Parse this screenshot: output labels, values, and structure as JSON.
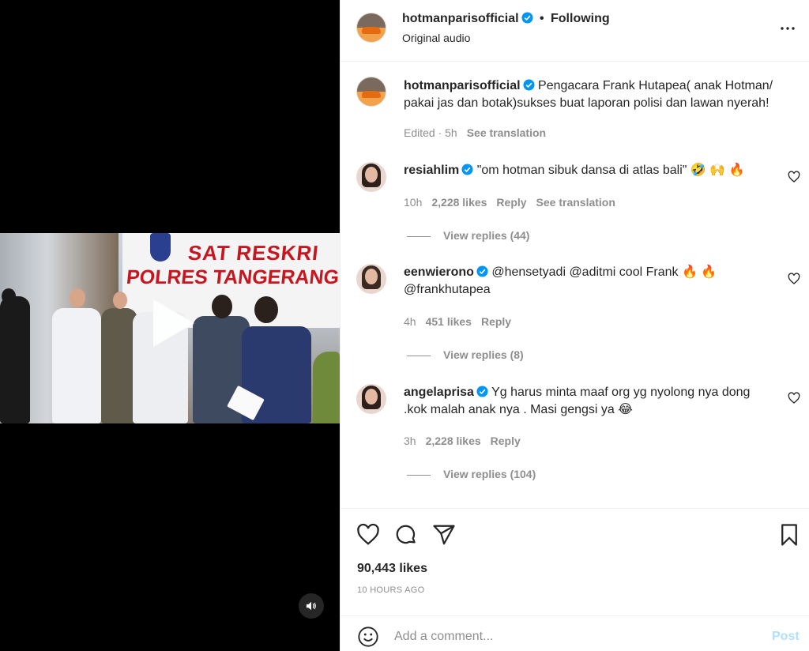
{
  "post": {
    "username": "hotmanparisofficial",
    "follow_separator": "•",
    "follow_status": "Following",
    "audio": "Original audio",
    "caption_user": "hotmanparisofficial",
    "caption": "Pengacara Frank Hutapea( anak Hotman/ pakai jas dan botak)sukses buat laporan polisi dan lawan nyerah!",
    "caption_meta": {
      "edited": "Edited · 5h",
      "translation": "See translation"
    },
    "likes": "90,443 likes",
    "time": "10 HOURS AGO"
  },
  "video": {
    "banner_line1": "SAT RESKRI",
    "banner_line2": "POLRES TANGERANG"
  },
  "comments": [
    {
      "user": "resiahlim",
      "text": "\"om hotman sibuk dansa di atlas bali\" 🤣 🙌 🔥",
      "time": "10h",
      "likes": "2,228 likes",
      "reply": "Reply",
      "translation": "See translation",
      "view_replies": "View replies (44)"
    },
    {
      "user": "eenwierono",
      "text": "@hensetyadi @aditmi cool Frank 🔥 🔥 @frankhutapea",
      "time": "4h",
      "likes": "451 likes",
      "reply": "Reply",
      "view_replies": "View replies (8)"
    },
    {
      "user": "angelaprisa",
      "text": "Yg harus minta maaf org yg nyolong nya dong .kok malah anak nya . Masi gengsi ya 😂",
      "time": "3h",
      "likes": "2,228 likes",
      "reply": "Reply",
      "view_replies": "View replies (104)"
    }
  ],
  "composer": {
    "placeholder": "Add a comment...",
    "post_label": "Post"
  },
  "icons": {
    "verified": "verified-badge-icon",
    "more": "more-options-icon",
    "like": "heart-icon",
    "comment": "comment-icon",
    "share": "share-icon",
    "save": "bookmark-icon",
    "emoji": "emoji-icon",
    "play": "play-icon",
    "mute": "speaker-icon"
  },
  "colors": {
    "verified_blue": "#0095f6",
    "post_disabled": "#b2dffc",
    "muted_text": "#8e8e8e"
  }
}
